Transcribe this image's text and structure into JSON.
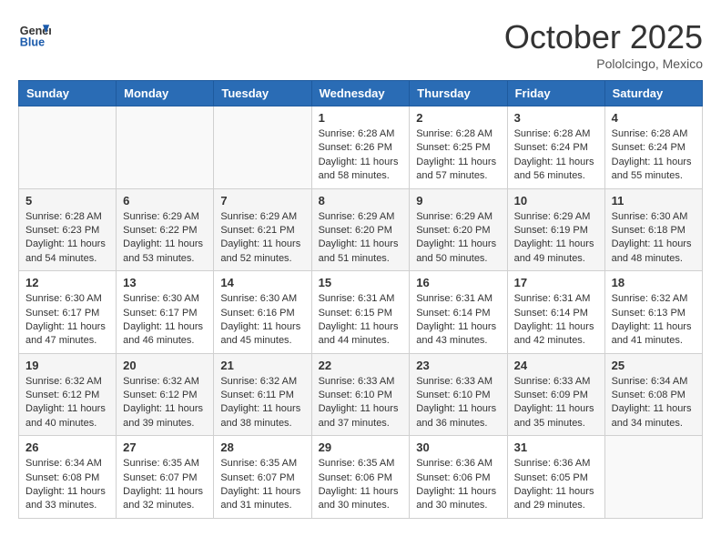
{
  "header": {
    "logo_line1": "General",
    "logo_line2": "Blue",
    "month": "October 2025",
    "location": "Pololcingo, Mexico"
  },
  "weekdays": [
    "Sunday",
    "Monday",
    "Tuesday",
    "Wednesday",
    "Thursday",
    "Friday",
    "Saturday"
  ],
  "weeks": [
    [
      {
        "day": "",
        "info": ""
      },
      {
        "day": "",
        "info": ""
      },
      {
        "day": "",
        "info": ""
      },
      {
        "day": "1",
        "info": "Sunrise: 6:28 AM\nSunset: 6:26 PM\nDaylight: 11 hours\nand 58 minutes."
      },
      {
        "day": "2",
        "info": "Sunrise: 6:28 AM\nSunset: 6:25 PM\nDaylight: 11 hours\nand 57 minutes."
      },
      {
        "day": "3",
        "info": "Sunrise: 6:28 AM\nSunset: 6:24 PM\nDaylight: 11 hours\nand 56 minutes."
      },
      {
        "day": "4",
        "info": "Sunrise: 6:28 AM\nSunset: 6:24 PM\nDaylight: 11 hours\nand 55 minutes."
      }
    ],
    [
      {
        "day": "5",
        "info": "Sunrise: 6:28 AM\nSunset: 6:23 PM\nDaylight: 11 hours\nand 54 minutes."
      },
      {
        "day": "6",
        "info": "Sunrise: 6:29 AM\nSunset: 6:22 PM\nDaylight: 11 hours\nand 53 minutes."
      },
      {
        "day": "7",
        "info": "Sunrise: 6:29 AM\nSunset: 6:21 PM\nDaylight: 11 hours\nand 52 minutes."
      },
      {
        "day": "8",
        "info": "Sunrise: 6:29 AM\nSunset: 6:20 PM\nDaylight: 11 hours\nand 51 minutes."
      },
      {
        "day": "9",
        "info": "Sunrise: 6:29 AM\nSunset: 6:20 PM\nDaylight: 11 hours\nand 50 minutes."
      },
      {
        "day": "10",
        "info": "Sunrise: 6:29 AM\nSunset: 6:19 PM\nDaylight: 11 hours\nand 49 minutes."
      },
      {
        "day": "11",
        "info": "Sunrise: 6:30 AM\nSunset: 6:18 PM\nDaylight: 11 hours\nand 48 minutes."
      }
    ],
    [
      {
        "day": "12",
        "info": "Sunrise: 6:30 AM\nSunset: 6:17 PM\nDaylight: 11 hours\nand 47 minutes."
      },
      {
        "day": "13",
        "info": "Sunrise: 6:30 AM\nSunset: 6:17 PM\nDaylight: 11 hours\nand 46 minutes."
      },
      {
        "day": "14",
        "info": "Sunrise: 6:30 AM\nSunset: 6:16 PM\nDaylight: 11 hours\nand 45 minutes."
      },
      {
        "day": "15",
        "info": "Sunrise: 6:31 AM\nSunset: 6:15 PM\nDaylight: 11 hours\nand 44 minutes."
      },
      {
        "day": "16",
        "info": "Sunrise: 6:31 AM\nSunset: 6:14 PM\nDaylight: 11 hours\nand 43 minutes."
      },
      {
        "day": "17",
        "info": "Sunrise: 6:31 AM\nSunset: 6:14 PM\nDaylight: 11 hours\nand 42 minutes."
      },
      {
        "day": "18",
        "info": "Sunrise: 6:32 AM\nSunset: 6:13 PM\nDaylight: 11 hours\nand 41 minutes."
      }
    ],
    [
      {
        "day": "19",
        "info": "Sunrise: 6:32 AM\nSunset: 6:12 PM\nDaylight: 11 hours\nand 40 minutes."
      },
      {
        "day": "20",
        "info": "Sunrise: 6:32 AM\nSunset: 6:12 PM\nDaylight: 11 hours\nand 39 minutes."
      },
      {
        "day": "21",
        "info": "Sunrise: 6:32 AM\nSunset: 6:11 PM\nDaylight: 11 hours\nand 38 minutes."
      },
      {
        "day": "22",
        "info": "Sunrise: 6:33 AM\nSunset: 6:10 PM\nDaylight: 11 hours\nand 37 minutes."
      },
      {
        "day": "23",
        "info": "Sunrise: 6:33 AM\nSunset: 6:10 PM\nDaylight: 11 hours\nand 36 minutes."
      },
      {
        "day": "24",
        "info": "Sunrise: 6:33 AM\nSunset: 6:09 PM\nDaylight: 11 hours\nand 35 minutes."
      },
      {
        "day": "25",
        "info": "Sunrise: 6:34 AM\nSunset: 6:08 PM\nDaylight: 11 hours\nand 34 minutes."
      }
    ],
    [
      {
        "day": "26",
        "info": "Sunrise: 6:34 AM\nSunset: 6:08 PM\nDaylight: 11 hours\nand 33 minutes."
      },
      {
        "day": "27",
        "info": "Sunrise: 6:35 AM\nSunset: 6:07 PM\nDaylight: 11 hours\nand 32 minutes."
      },
      {
        "day": "28",
        "info": "Sunrise: 6:35 AM\nSunset: 6:07 PM\nDaylight: 11 hours\nand 31 minutes."
      },
      {
        "day": "29",
        "info": "Sunrise: 6:35 AM\nSunset: 6:06 PM\nDaylight: 11 hours\nand 30 minutes."
      },
      {
        "day": "30",
        "info": "Sunrise: 6:36 AM\nSunset: 6:06 PM\nDaylight: 11 hours\nand 30 minutes."
      },
      {
        "day": "31",
        "info": "Sunrise: 6:36 AM\nSunset: 6:05 PM\nDaylight: 11 hours\nand 29 minutes."
      },
      {
        "day": "",
        "info": ""
      }
    ]
  ]
}
